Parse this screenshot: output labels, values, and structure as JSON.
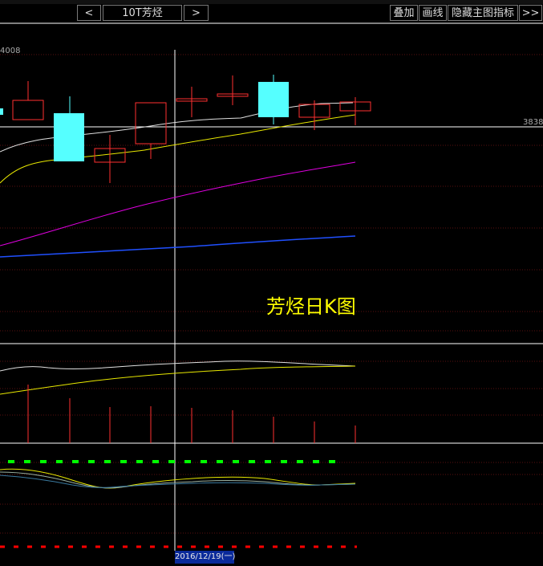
{
  "toolbar": {
    "prev_label": "<",
    "symbol_label": "10T芳烃",
    "next_label": ">",
    "overlay_label": "叠加",
    "draw_label": "画线",
    "hide_indicator_label": "隐藏主图指标",
    "more_label": ">>"
  },
  "main_panel": {
    "top_price": "4008",
    "right_price": "3838",
    "chart_title": "芳烃日K图"
  },
  "cursor": {
    "date": "2016/12/19(一)"
  },
  "colors": {
    "up_candle": "#ff3030",
    "down_candle": "#55ffff",
    "ma_white": "#e0e0e0",
    "ma_yellow": "#e8e800",
    "ma_magenta": "#e000e0",
    "ma_blue": "#2050ff",
    "grid": "#6a1010",
    "accent_yellow": "#ffff00",
    "green_dots": "#00ff00",
    "red_dots": "#ff0000"
  }
}
